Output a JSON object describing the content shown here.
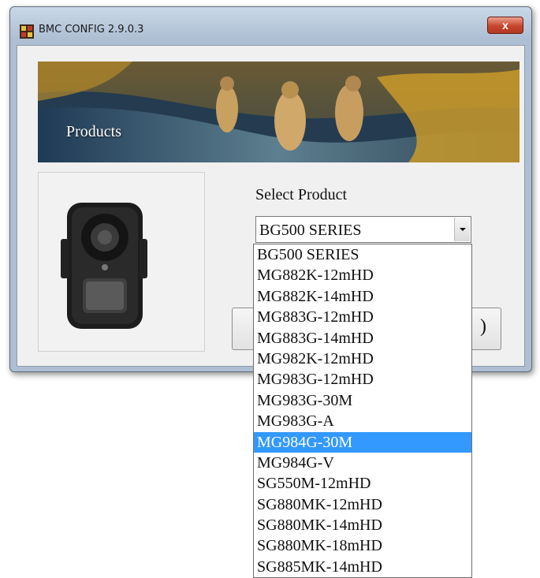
{
  "window": {
    "title": "BMC CONFIG 2.9.0.3",
    "close_label": "x"
  },
  "banner": {
    "label": "Products"
  },
  "product_select": {
    "label": "Select Product",
    "value": "BG500 SERIES",
    "options": [
      "BG500 SERIES",
      "MG882K-12mHD",
      "MG882K-14mHD",
      "MG883G-12mHD",
      "MG883G-14mHD",
      "MG982K-12mHD",
      "MG983G-12mHD",
      "MG983G-30M",
      "MG983G-A",
      "MG984G-30M",
      "MG984G-V",
      "SG550M-12mHD",
      "SG880MK-12mHD",
      "SG880MK-14mHD",
      "SG880MK-18mHD",
      "SG885MK-14mHD"
    ],
    "highlighted": "MG984G-30M"
  },
  "button_partial": {
    "visible_text": ")"
  },
  "colors": {
    "highlight": "#3399ff",
    "close_button": "#c8452c"
  }
}
